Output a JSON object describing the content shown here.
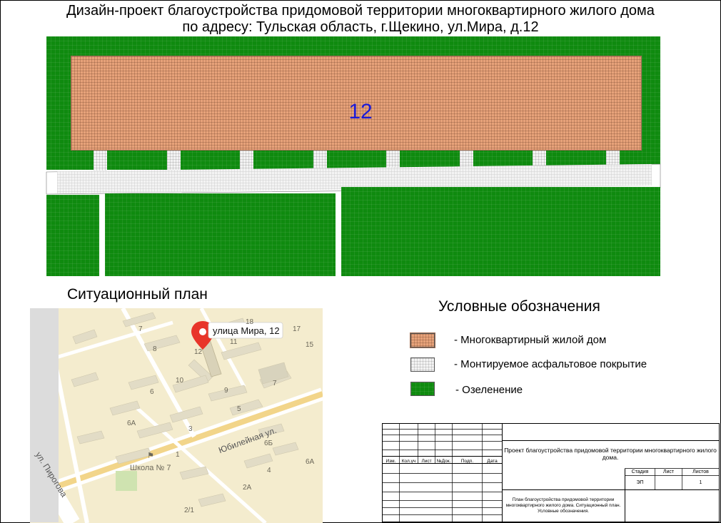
{
  "title": {
    "line1": "Дизайн-проект благоустройства придомовой территории многоквартирного жилого дома",
    "line2": "по адресу: Тульская область, г.Щекино, ул.Мира, д.12"
  },
  "plan": {
    "house_number": "12"
  },
  "situation_plan": {
    "title": "Ситуационный план",
    "pin_label": "улица Мира, 12",
    "street_labels": [
      "Юбилейная ул.",
      "ул. Пирогова"
    ],
    "school_label": "Школа № 7",
    "house_numbers": [
      "7",
      "8",
      "10",
      "12",
      "18",
      "17",
      "15",
      "11",
      "6",
      "9",
      "7",
      "5",
      "6А",
      "3",
      "6Б",
      "6А",
      "4",
      "2А",
      "1",
      "2/1"
    ]
  },
  "legend": {
    "title": "Условные обозначения",
    "items": [
      {
        "label": "- Многоквартирный жилой дом",
        "swatch": "building"
      },
      {
        "label": "- Монтируемое асфальтовое покрытие",
        "swatch": "asphalt"
      },
      {
        "label": "- Озеленение",
        "swatch": "greenery"
      }
    ]
  },
  "title_block": {
    "columns": [
      "Изм.",
      "Кол.уч",
      "Лист",
      "№Док.",
      "Подп.",
      "Дата"
    ],
    "project_name": "Проект благоустройства придомовой территории многоквартирного жилого дома.",
    "stage_header": "Стадия",
    "sheet_header": "Лист",
    "sheets_header": "Листов",
    "stage_value": "ЭП",
    "sheet_value": "",
    "sheets_value": "1",
    "sheet_title": "План благоустройства придомовой территории многоквартирного жилого дома. Ситуационный план. Условные обозначения."
  },
  "colors": {
    "building": "#e7a27a",
    "asphalt": "#f3f3f3",
    "greenery": "#0f8a0f",
    "house_number": "#1b1bd8",
    "map_background": "#f4ecce",
    "pin": "#e8352a"
  }
}
